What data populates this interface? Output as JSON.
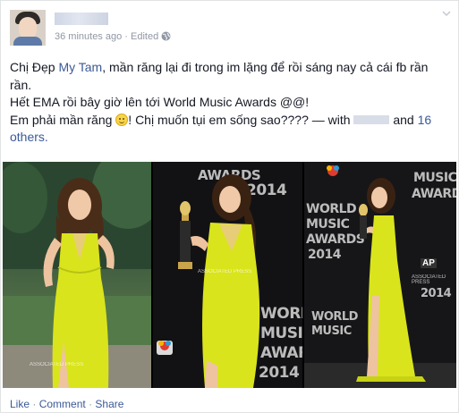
{
  "post": {
    "timestamp": "36 minutes ago",
    "separator": "·",
    "edited": "Edited",
    "message": {
      "line1_pre": "Chị Đẹp ",
      "line1_link": "My Tam",
      "line1_post": ", mần răng lại đi trong im lặng để rồi sáng nay cả cái fb rần",
      "line2": "rần.",
      "line3": "Hết EMA rồi bây giờ lên tới World Music Awards @@!",
      "line4_pre": "Em phải mần răng ",
      "line4_post": "! Chị muốn tụi em sống sao???? — with ",
      "line4_and": " and ",
      "line4_count": "16",
      "line5": "others."
    },
    "photos": {
      "award_text": [
        "AWARDS",
        "2014",
        "WORLD",
        "MUSIC",
        "AWARDS",
        "2014"
      ],
      "watermark": "ASSOCIATED PRESS",
      "ap_label": "AP"
    },
    "actions": {
      "like": "Like",
      "comment": "Comment",
      "share": "Share",
      "dot": "·"
    }
  }
}
